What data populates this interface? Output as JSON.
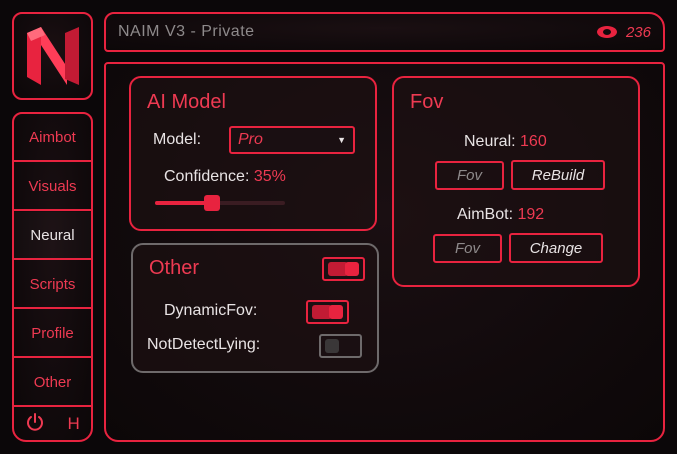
{
  "app": {
    "title": "NAIM V3 - Private",
    "counter": "236"
  },
  "sidebar": {
    "items": [
      {
        "label": "Aimbot",
        "active": false
      },
      {
        "label": "Visuals",
        "active": false
      },
      {
        "label": "Neural",
        "active": true
      },
      {
        "label": "Scripts",
        "active": false
      },
      {
        "label": "Profile",
        "active": false
      },
      {
        "label": "Other",
        "active": false
      }
    ],
    "footer_letter": "H"
  },
  "ai_model": {
    "title": "AI Model",
    "model_label": "Model:",
    "model_value": "Pro",
    "confidence_label": "Confidence:",
    "confidence_value": "35%",
    "confidence_slider": 0.35
  },
  "other": {
    "title": "Other",
    "master_toggle": true,
    "dynamic_fov_label": "DynamicFov:",
    "dynamic_fov": true,
    "not_detect_lying_label": "NotDetectLying:",
    "not_detect_lying": false
  },
  "fov": {
    "title": "Fov",
    "neural_label": "Neural:",
    "neural_value": "160",
    "neural_buttons": [
      "Fov",
      "ReBuild"
    ],
    "aimbot_label": "AimBot:",
    "aimbot_value": "192",
    "aimbot_buttons": [
      "Fov",
      "Change"
    ]
  },
  "colors": {
    "accent": "#e8233f",
    "text": "#e8e3e4",
    "muted": "#8e8a8b",
    "background": "#0b0709"
  }
}
